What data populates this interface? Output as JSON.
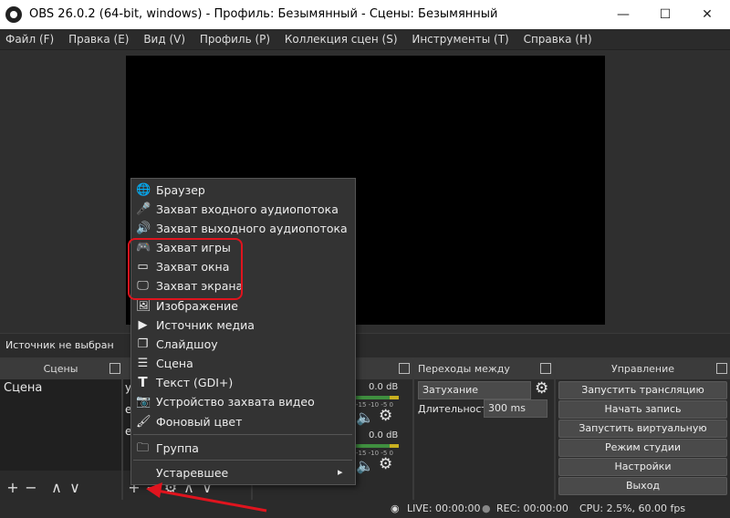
{
  "window": {
    "title": "OBS 26.0.2 (64-bit, windows) - Профиль: Безымянный - Сцены: Безымянный",
    "minimize": "—",
    "maximize": "☐",
    "close": "✕"
  },
  "menubar": [
    "Файл (F)",
    "Правка (E)",
    "Вид (V)",
    "Профиль (P)",
    "Коллекция сцен (S)",
    "Инструменты (T)",
    "Справка (H)"
  ],
  "source_status": "Источник не выбран",
  "scenes": {
    "title": "Сцены",
    "items": [
      "Сцена"
    ]
  },
  "sources_partial": {
    "visible_letters": [
      "у",
      "е",
      "е"
    ]
  },
  "mixer": {
    "db1": "0.0 dB",
    "db2": "0.0 dB",
    "scale": "-15  -10  -5  0"
  },
  "transitions": {
    "title": "Переходы между сценами",
    "type": "Затухание",
    "duration_label": "Длительность",
    "duration_value": "300 ms"
  },
  "controls": {
    "title": "Управление",
    "buttons": [
      "Запустить трансляцию",
      "Начать запись",
      "Запустить виртуальную камеру",
      "Режим студии",
      "Настройки",
      "Выход"
    ]
  },
  "status": {
    "live": "LIVE: 00:00:00",
    "rec": "REC: 00:00:00",
    "cpu": "CPU: 2.5%, 60.00 fps"
  },
  "context_menu": {
    "items": [
      {
        "label": "Браузер",
        "icon": "globe-icon"
      },
      {
        "label": "Захват входного аудиопотока",
        "icon": "microphone-icon"
      },
      {
        "label": "Захват выходного аудиопотока",
        "icon": "speaker-icon"
      },
      {
        "label": "Захват игры",
        "icon": "gamepad-icon"
      },
      {
        "label": "Захват окна",
        "icon": "window-icon"
      },
      {
        "label": "Захват экрана",
        "icon": "monitor-icon"
      },
      {
        "label": "Изображение",
        "icon": "image-icon"
      },
      {
        "label": "Источник медиа",
        "icon": "play-icon"
      },
      {
        "label": "Слайдшоу",
        "icon": "slideshow-icon"
      },
      {
        "label": "Сцена",
        "icon": "list-icon"
      },
      {
        "label": "Текст (GDI+)",
        "icon": "text-icon"
      },
      {
        "label": "Устройство захвата видео",
        "icon": "camera-icon"
      },
      {
        "label": "Фоновый цвет",
        "icon": "brush-icon"
      },
      {
        "label": "Группа",
        "icon": "folder-icon"
      },
      {
        "label": "Устаревшее",
        "icon": ""
      }
    ],
    "submenu_arrow": "▸"
  },
  "colors": {
    "highlight": "#e0141e",
    "arrow": "#e0141e"
  }
}
